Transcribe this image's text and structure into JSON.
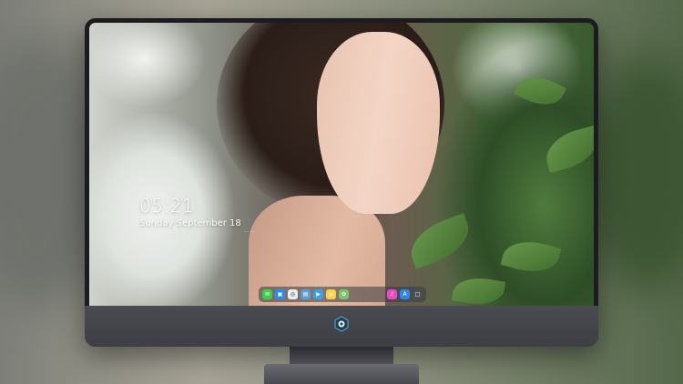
{
  "lockscreen": {
    "time": "05:21",
    "date": "Sunday September 18",
    "extra": "… …"
  },
  "dock": {
    "apps": [
      {
        "name": "messages-icon",
        "color": "#3ccf4e",
        "glyph": "✉"
      },
      {
        "name": "finder-icon",
        "color": "#2a8cf0",
        "glyph": "▣"
      },
      {
        "name": "safari-icon",
        "color": "#e9eef2",
        "glyph": "◎"
      },
      {
        "name": "preview-icon",
        "color": "#5a9fd8",
        "glyph": "▤"
      },
      {
        "name": "video-icon",
        "color": "#3aa0e8",
        "glyph": "▶"
      },
      {
        "name": "notes-icon",
        "color": "#f6d24a",
        "glyph": "≡"
      },
      {
        "name": "photos-icon",
        "color": "#7bc46a",
        "glyph": "✿"
      },
      {
        "name": "music-icon",
        "color": "#e94bc4",
        "glyph": "♪"
      },
      {
        "name": "appstore-icon",
        "color": "#2f86f0",
        "glyph": "A"
      },
      {
        "name": "monitor-icon",
        "color": "#4a4e55",
        "glyph": "□"
      }
    ]
  },
  "colors": {
    "bezel": "#1c1b20",
    "chin": "#45454c",
    "logo_accent": "#3fb4e6"
  }
}
